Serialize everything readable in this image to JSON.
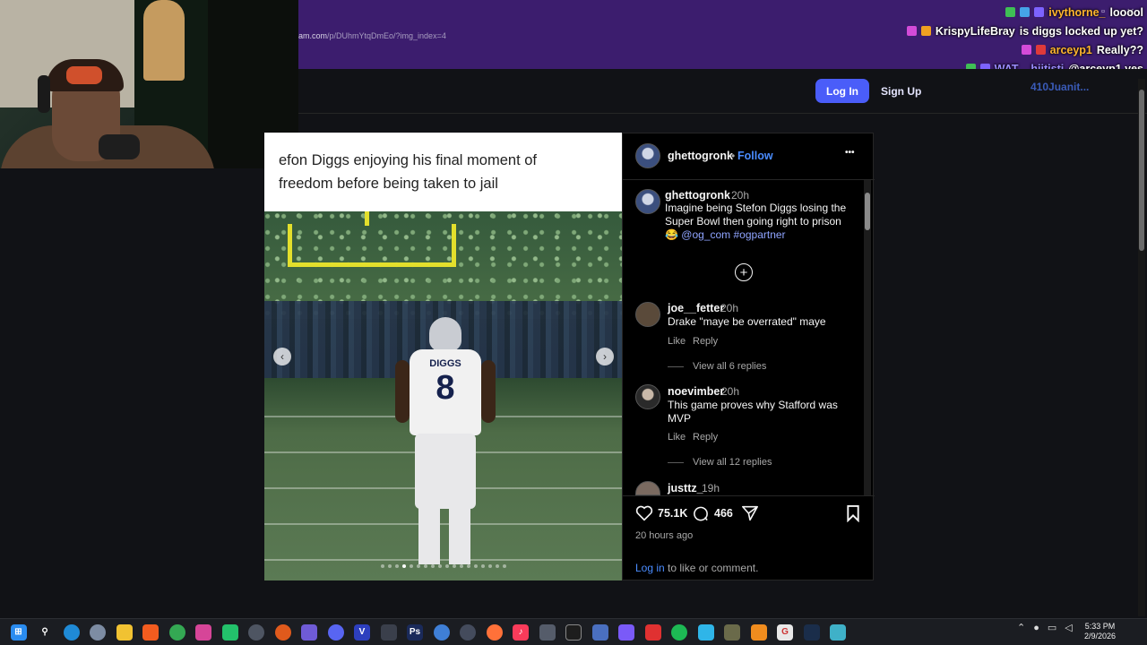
{
  "browser": {
    "url_domain": "am.com",
    "url_path": "/p/DUhmYtqDmEo/?img_index=4"
  },
  "chat": [
    {
      "user": "ivythorne_",
      "message": "looool",
      "color": "#ffb52e"
    },
    {
      "user": "KrispyLifeBray",
      "message": "is diggs locked up yet?",
      "color": "#ffffff"
    },
    {
      "user": "arceyp1",
      "message": "Really??",
      "color": "#ffb52e"
    },
    {
      "user": "WAT__hiitistj",
      "message": "@arceyp1 yes",
      "color": "#9b8dff"
    }
  ],
  "header": {
    "login_label": "Log In",
    "signup_label": "Sign Up",
    "ghost_user": "410Juanit..."
  },
  "post": {
    "image_caption": "efon Diggs enjoying his final moment of freedom before being taken to jail",
    "caption_line1": "efon Diggs enjoying his final moment of",
    "caption_line2": "freedom before being taken to jail",
    "jersey_name": "DIGGS",
    "jersey_number": "8",
    "prev_arrow": "‹",
    "next_arrow": "›",
    "slide_count": 18,
    "active_slide": 3
  },
  "side": {
    "author": "ghettogronk",
    "follow_label": "Follow",
    "more_label": "•••",
    "caption": {
      "user": "ghettogronk",
      "time": "20h",
      "text": "Imagine being Stefon Diggs losing the Super Bowl then going right to prison",
      "emoji": "😂",
      "tags": "@og_com #ogpartner"
    },
    "comments": [
      {
        "user": "joe__fetter",
        "time": "20h",
        "text": "Drake \"maye be overrated\" maye",
        "like": "Like",
        "reply": "Reply",
        "view_replies": "View all 6 replies"
      },
      {
        "user": "noevimber",
        "time": "20h",
        "text": "This game proves why Stafford was MVP",
        "like": "Like",
        "reply": "Reply",
        "view_replies": "View all 12 replies"
      },
      {
        "user": "justtz_",
        "time": "19h"
      }
    ],
    "likes": "75.1K",
    "comments_count": "466",
    "posted_ago": "20 hours ago",
    "login_link": "Log in",
    "login_text": "to like or comment."
  },
  "taskbar": {
    "time": "5:33 PM",
    "date": "2/9/2026"
  }
}
